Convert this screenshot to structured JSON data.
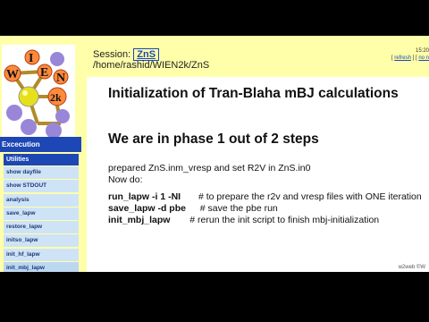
{
  "sidebar": {
    "logo_letters": [
      "W",
      "I",
      "E",
      "N",
      "2k"
    ],
    "execution_label": "Excecution",
    "utilities_label": "Utilities",
    "items": [
      {
        "label": "show dayfile"
      },
      {
        "label": "show STDOUT"
      },
      {
        "label": "analysis"
      },
      {
        "label": "save_lapw"
      },
      {
        "label": "restore_lapw"
      },
      {
        "label": "initso_lapw"
      },
      {
        "label": "init_hf_lapw"
      },
      {
        "label": "init_mbj_lapw"
      }
    ]
  },
  "header": {
    "session_label": "Session:",
    "session_name": "ZnS",
    "path": "/home/rashid/WIEN2k/ZnS",
    "time": "15:20",
    "refresh_label": "refresh",
    "no_label": "no n"
  },
  "main": {
    "title": "Initialization of Tran-Blaha mBJ calculations",
    "phase": "We are in phase 1 out of 2 steps",
    "prepared": "prepared ZnS.inm_vresp and set R2V in ZnS.in0",
    "now_do": "Now do:",
    "commands": [
      {
        "cmd": "run_lapw -i 1 -NI",
        "comment": "# to prepare the r2v and vresp files with ONE iteration"
      },
      {
        "cmd": "save_lapw -d pbe",
        "comment": "# save the pbe run"
      },
      {
        "cmd": "init_mbj_lapw",
        "comment": "# rerun the init script to finish mbj-initialization"
      }
    ],
    "footer": "w2web ©W"
  },
  "colors": {
    "background": "#ffffaa",
    "menu_header": "#1c47b4",
    "menu_item": "#cfe3f6"
  }
}
